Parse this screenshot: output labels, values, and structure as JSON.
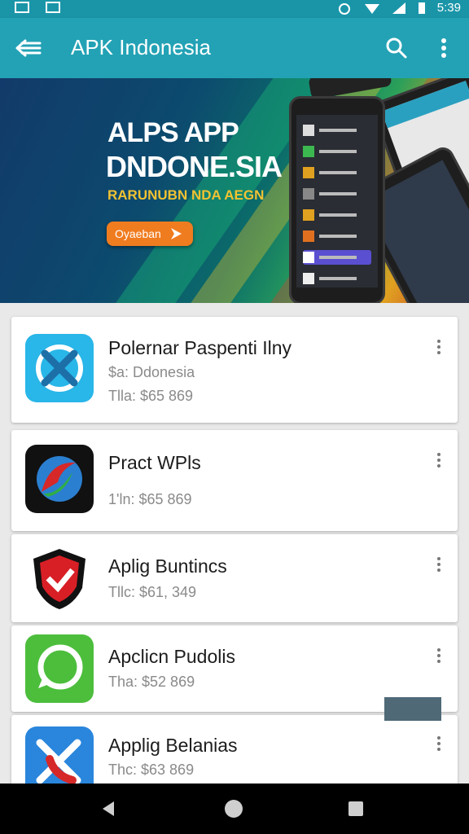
{
  "status_bar": {
    "time": "5:39"
  },
  "app_bar": {
    "title": "APK Indonesia"
  },
  "banner": {
    "line1": "ALPS APP",
    "line2": "DNDONE.SIA",
    "line3": "RARUNUBN NDA AEGN",
    "cta_label": "Oyaeban"
  },
  "apps": [
    {
      "title": "Polernar Paspenti Ilny",
      "subtitle": "$a: Ddonesia",
      "meta": "Tlla: $65 869",
      "icon": "crossed-x-icon",
      "color": "#29b6e8"
    },
    {
      "title": "Pract WPls",
      "subtitle": "",
      "meta": "1'ln: $65 869",
      "icon": "swirl-logo-icon",
      "color": "#111111"
    },
    {
      "title": "Aplig Buntincs",
      "subtitle": "",
      "meta": "Tllc: $61, 349",
      "icon": "shield-check-icon",
      "color": "#d81f26"
    },
    {
      "title": "Apclicn Pudolis",
      "subtitle": "",
      "meta": "Tha: $52 869",
      "icon": "chat-bubble-icon",
      "color": "#4cbe3c"
    },
    {
      "title": "Applig Belanias",
      "subtitle": "",
      "meta": "Thc: $63 869",
      "icon": "phone-cross-icon",
      "color": "#2a86dc"
    }
  ]
}
